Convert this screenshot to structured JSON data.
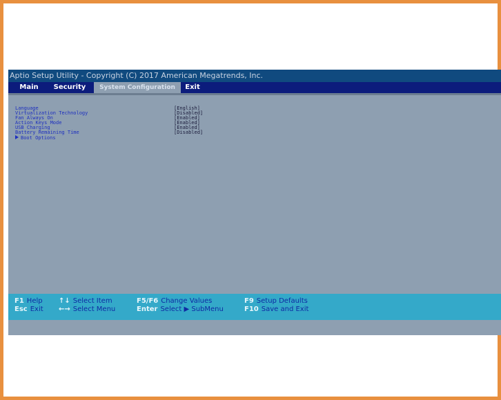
{
  "bios": {
    "title": "Aptio Setup Utility - Copyright (C) 2017 American Megatrends, Inc.",
    "tabs": [
      {
        "label": "Main",
        "active": false
      },
      {
        "label": "Security",
        "active": false
      },
      {
        "label": "System Configuration",
        "active": true
      },
      {
        "label": "Exit",
        "active": false
      }
    ],
    "settings": [
      {
        "label": "Language",
        "value": "[English]"
      },
      {
        "label": "Virtualization Technology",
        "value": "[Disabled]"
      },
      {
        "label": "Fan Always On",
        "value": "[Enabled]"
      },
      {
        "label": "Action Keys Mode",
        "value": "[Enabled]"
      },
      {
        "label": "USB Charging",
        "value": "[Enabled]"
      },
      {
        "label": "Battery Remaining Time",
        "value": "[Disabled]"
      }
    ],
    "submenu": {
      "label": "Boot Options"
    },
    "help": [
      {
        "key": "F1",
        "text": "Help"
      },
      {
        "key": "Esc",
        "text": "Exit"
      },
      {
        "key": "↑↓",
        "text": "Select Item"
      },
      {
        "key": "←→",
        "text": "Select Menu"
      },
      {
        "key": "F5/F6",
        "text": "Change Values"
      },
      {
        "key": "Enter",
        "text": "Select ▶ SubMenu"
      },
      {
        "key": "F9",
        "text": "Setup Defaults"
      },
      {
        "key": "F10",
        "text": "Save and Exit"
      }
    ]
  },
  "colors": {
    "frame_border": "#e8903f",
    "bios_background": "#8e9fb1",
    "title_bar": "#104a7f",
    "menu_bar": "#0c1c7c",
    "help_bar": "#34a9c9",
    "setting_text": "#1d2fbf"
  }
}
